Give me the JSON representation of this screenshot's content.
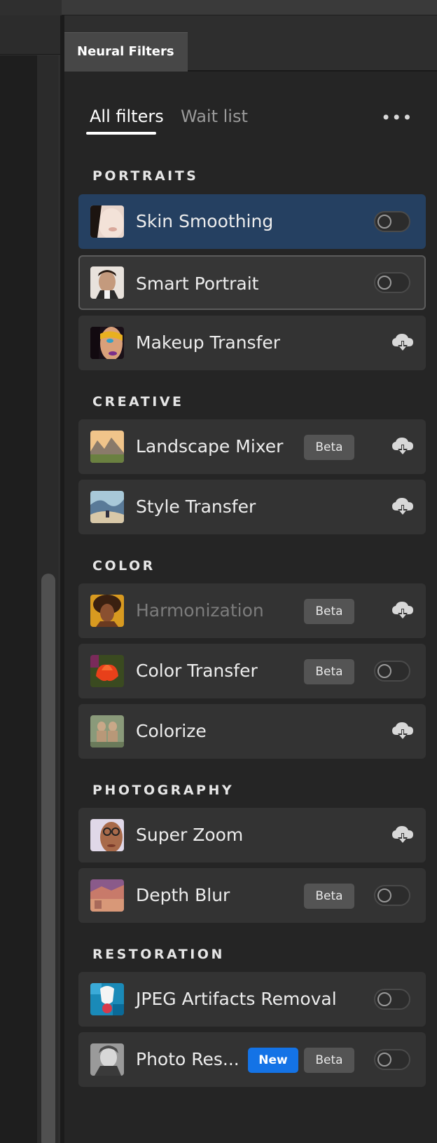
{
  "panel": {
    "title": "Neural Filters"
  },
  "tabs": {
    "all_filters": "All filters",
    "wait_list": "Wait list"
  },
  "menu": {
    "more_icon": "more-options-icon"
  },
  "sections": {
    "portraits": "PORTRAITS",
    "creative": "CREATIVE",
    "color": "COLOR",
    "photography": "PHOTOGRAPHY",
    "restoration": "RESTORATION"
  },
  "badges": {
    "beta": "Beta",
    "new": "New"
  },
  "filters": {
    "skin_smoothing": {
      "label": "Skin Smoothing",
      "state": "toggle-off",
      "selected": true
    },
    "smart_portrait": {
      "label": "Smart Portrait",
      "state": "toggle-off"
    },
    "makeup_transfer": {
      "label": "Makeup Transfer",
      "state": "download"
    },
    "landscape_mixer": {
      "label": "Landscape Mixer",
      "state": "download",
      "beta": true
    },
    "style_transfer": {
      "label": "Style Transfer",
      "state": "download"
    },
    "harmonization": {
      "label": "Harmonization",
      "state": "download",
      "beta": true,
      "disabled": true
    },
    "color_transfer": {
      "label": "Color Transfer",
      "state": "toggle-off",
      "beta": true
    },
    "colorize": {
      "label": "Colorize",
      "state": "download"
    },
    "super_zoom": {
      "label": "Super Zoom",
      "state": "download"
    },
    "depth_blur": {
      "label": "Depth Blur",
      "state": "toggle-off",
      "beta": true
    },
    "jpeg_artifacts_removal": {
      "label": "JPEG Artifacts Removal",
      "state": "toggle-off"
    },
    "photo_restoration": {
      "label": "Photo Res...",
      "state": "toggle-off",
      "beta": true,
      "new": true
    }
  },
  "colors": {
    "selected_row": "#254061",
    "new_badge": "#1473e6",
    "row_bg": "#333333"
  }
}
